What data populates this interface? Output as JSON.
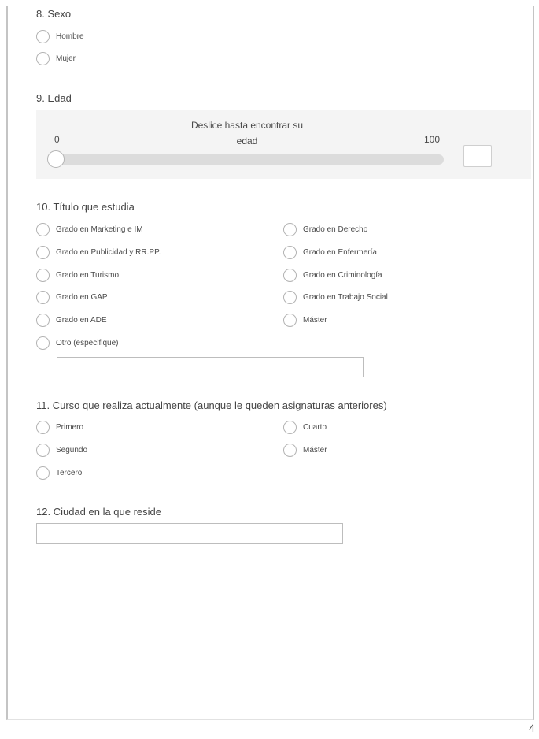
{
  "page_number": "4",
  "q8": {
    "title": "8. Sexo",
    "options": [
      "Hombre",
      "Mujer"
    ]
  },
  "q9": {
    "title": "9. Edad",
    "instruction_line1": "Deslice hasta encontrar su",
    "instruction_line2": "edad",
    "min_label": "0",
    "max_label": "100",
    "min": 0,
    "max": 100,
    "value": 0,
    "value_box": ""
  },
  "q10": {
    "title": "10. Título que estudia",
    "left_options": [
      "Grado en Marketing e IM",
      "Grado en Publicidad y RR.PP.",
      "Grado en Turismo",
      "Grado en GAP",
      "Grado en ADE",
      "Otro (especifique)"
    ],
    "right_options": [
      "Grado en Derecho",
      "Grado en Enfermería",
      "Grado en Criminología",
      "Grado en Trabajo Social",
      "Máster"
    ],
    "other_value": ""
  },
  "q11": {
    "title": "11. Curso que realiza actualmente (aunque le queden asignaturas anteriores)",
    "left_options": [
      "Primero",
      "Segundo",
      "Tercero"
    ],
    "right_options": [
      "Cuarto",
      "Máster"
    ]
  },
  "q12": {
    "title": "12. Ciudad en la que reside",
    "value": ""
  }
}
